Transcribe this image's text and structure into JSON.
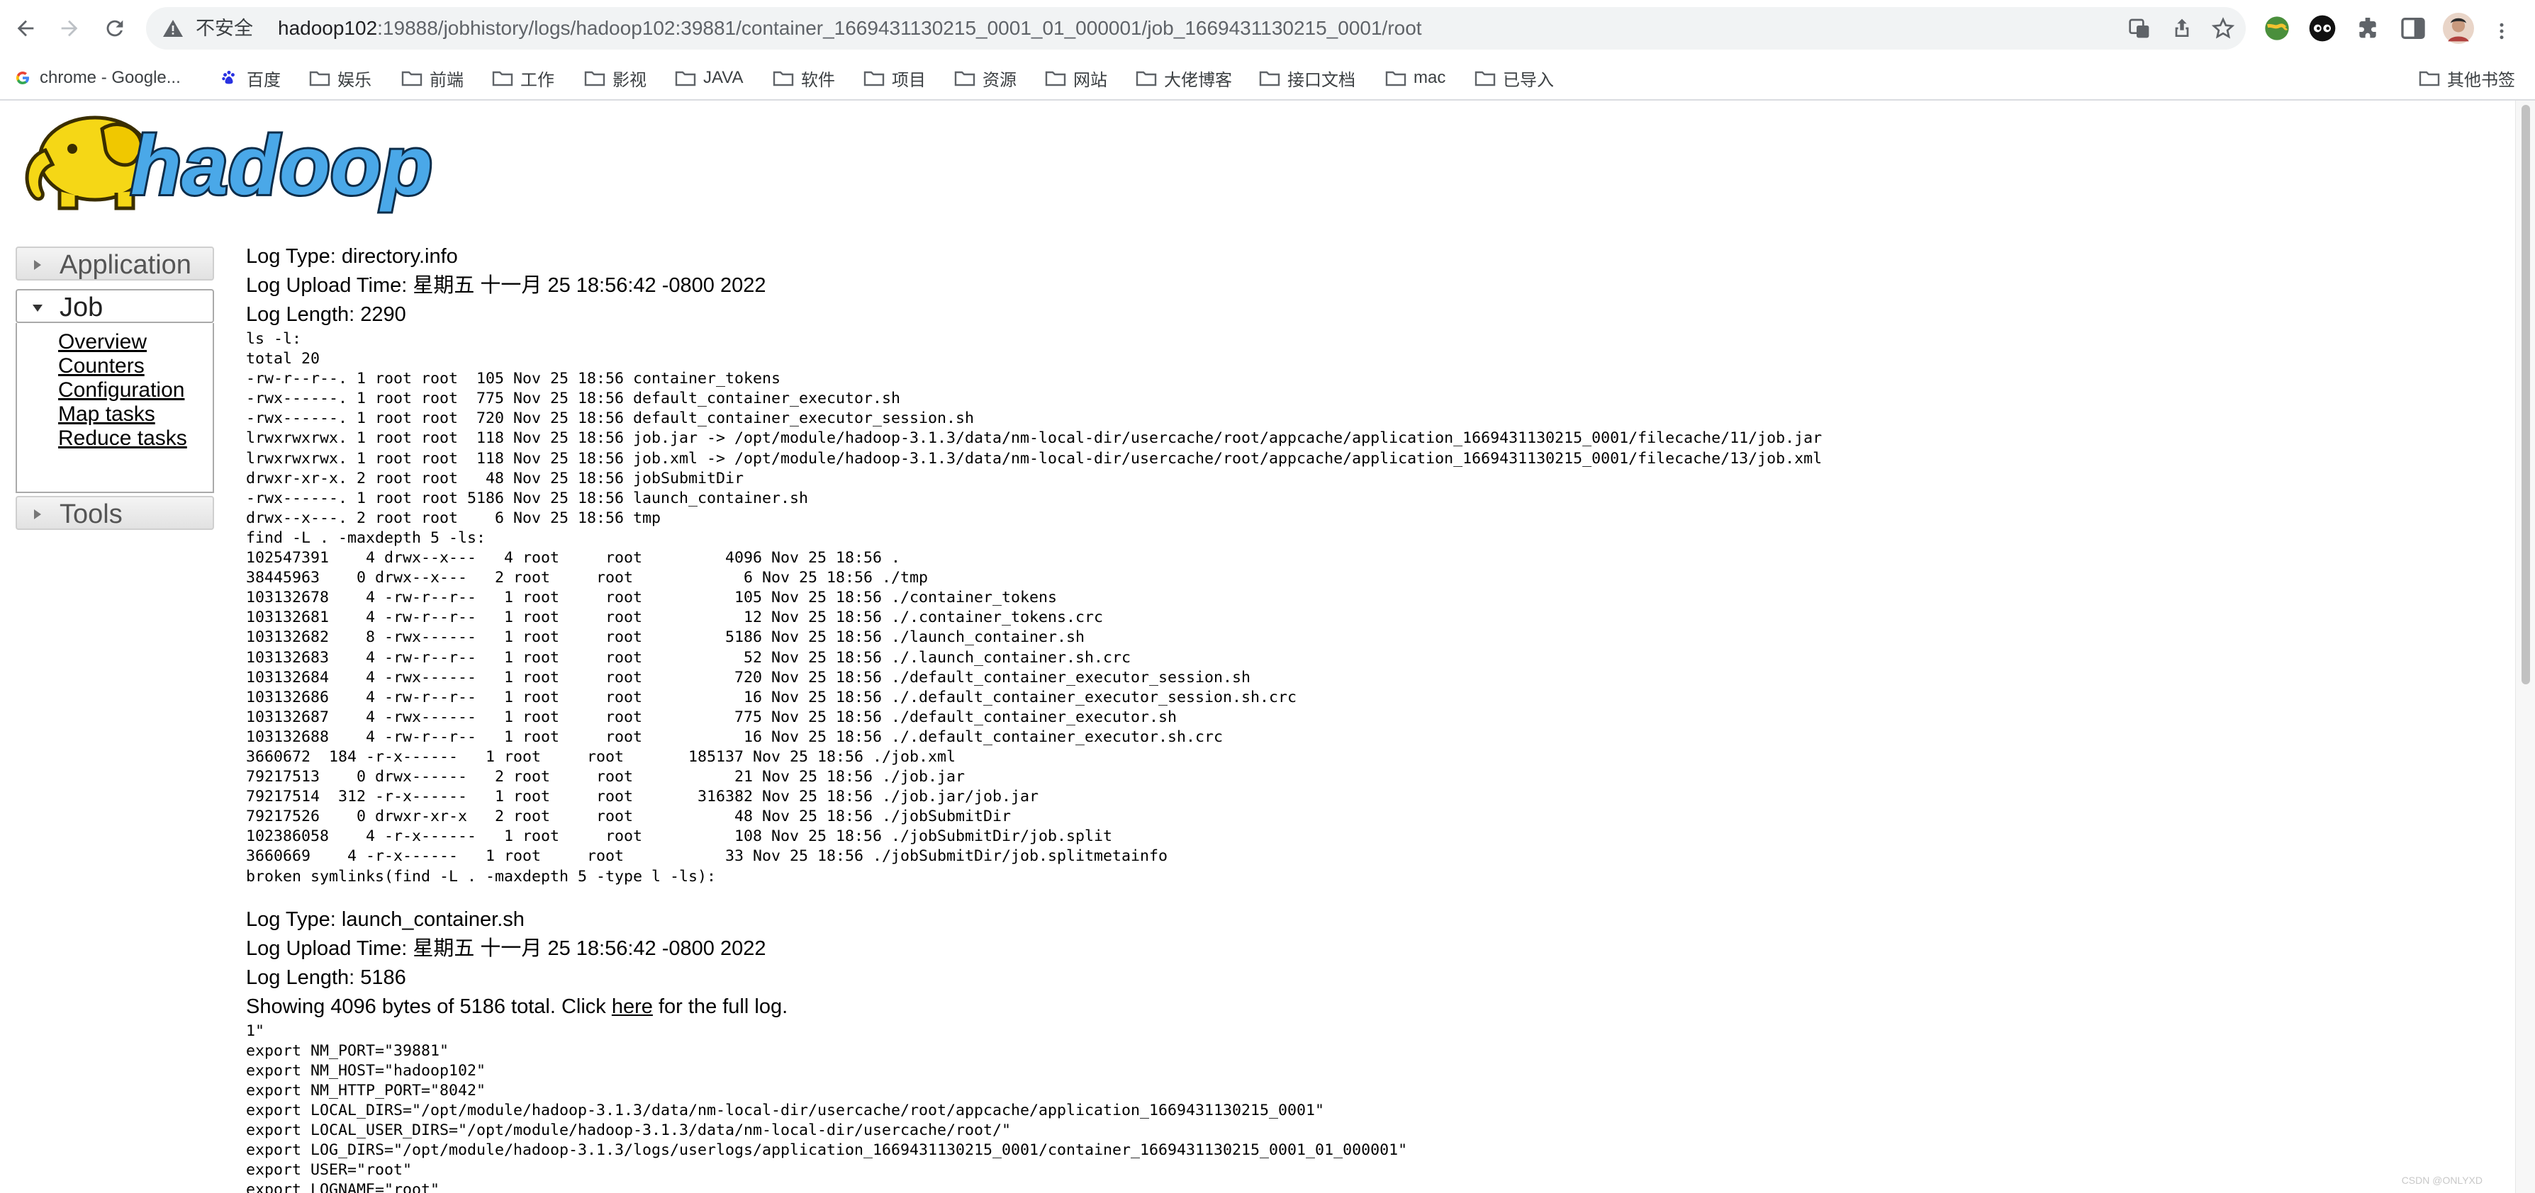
{
  "browser": {
    "insecure_label": "不安全",
    "url_host": "hadoop102",
    "url_rest": ":19888/jobhistory/logs/hadoop102:39881/container_1669431130215_0001_01_000001/job_1669431130215_0001/root",
    "bookmarks": [
      "chrome - Google...",
      "百度",
      "娱乐",
      "前端",
      "工作",
      "影视",
      "JAVA",
      "软件",
      "项目",
      "资源",
      "网站",
      "大佬博客",
      "接口文档",
      "mac",
      "已导入"
    ],
    "other_bookmarks": "其他书签"
  },
  "logo_text": "hadoop",
  "nav": {
    "application": "Application",
    "job": "Job",
    "job_links": [
      "Overview",
      "Counters",
      "Configuration",
      "Map tasks",
      "Reduce tasks"
    ],
    "tools": "Tools"
  },
  "log1": {
    "type": "Log Type: directory.info",
    "upload": "Log Upload Time: 星期五 十一月 25 18:56:42 -0800 2022",
    "length": "Log Length: 2290",
    "body": "ls -l:\ntotal 20\n-rw-r--r--. 1 root root  105 Nov 25 18:56 container_tokens\n-rwx------. 1 root root  775 Nov 25 18:56 default_container_executor.sh\n-rwx------. 1 root root  720 Nov 25 18:56 default_container_executor_session.sh\nlrwxrwxrwx. 1 root root  118 Nov 25 18:56 job.jar -> /opt/module/hadoop-3.1.3/data/nm-local-dir/usercache/root/appcache/application_1669431130215_0001/filecache/11/job.jar\nlrwxrwxrwx. 1 root root  118 Nov 25 18:56 job.xml -> /opt/module/hadoop-3.1.3/data/nm-local-dir/usercache/root/appcache/application_1669431130215_0001/filecache/13/job.xml\ndrwxr-xr-x. 2 root root   48 Nov 25 18:56 jobSubmitDir\n-rwx------. 1 root root 5186 Nov 25 18:56 launch_container.sh\ndrwx--x---. 2 root root    6 Nov 25 18:56 tmp\nfind -L . -maxdepth 5 -ls:\n102547391    4 drwx--x---   4 root     root         4096 Nov 25 18:56 .\n38445963    0 drwx--x---   2 root     root            6 Nov 25 18:56 ./tmp\n103132678    4 -rw-r--r--   1 root     root          105 Nov 25 18:56 ./container_tokens\n103132681    4 -rw-r--r--   1 root     root           12 Nov 25 18:56 ./.container_tokens.crc\n103132682    8 -rwx------   1 root     root         5186 Nov 25 18:56 ./launch_container.sh\n103132683    4 -rw-r--r--   1 root     root           52 Nov 25 18:56 ./.launch_container.sh.crc\n103132684    4 -rwx------   1 root     root          720 Nov 25 18:56 ./default_container_executor_session.sh\n103132686    4 -rw-r--r--   1 root     root           16 Nov 25 18:56 ./.default_container_executor_session.sh.crc\n103132687    4 -rwx------   1 root     root          775 Nov 25 18:56 ./default_container_executor.sh\n103132688    4 -rw-r--r--   1 root     root           16 Nov 25 18:56 ./.default_container_executor.sh.crc\n3660672  184 -r-x------   1 root     root       185137 Nov 25 18:56 ./job.xml\n79217513    0 drwx------   2 root     root           21 Nov 25 18:56 ./job.jar\n79217514  312 -r-x------   1 root     root       316382 Nov 25 18:56 ./job.jar/job.jar\n79217526    0 drwxr-xr-x   2 root     root           48 Nov 25 18:56 ./jobSubmitDir\n102386058    4 -r-x------   1 root     root          108 Nov 25 18:56 ./jobSubmitDir/job.split\n3660669    4 -r-x------   1 root     root           33 Nov 25 18:56 ./jobSubmitDir/job.splitmetainfo\nbroken symlinks(find -L . -maxdepth 5 -type l -ls):"
  },
  "log2": {
    "type": "Log Type: launch_container.sh",
    "upload": "Log Upload Time: 星期五 十一月 25 18:56:42 -0800 2022",
    "length": "Log Length: 5186",
    "showing_pre": "Showing 4096 bytes of 5186 total. Click ",
    "here": "here",
    "showing_post": " for the full log.",
    "body": "1\"\nexport NM_PORT=\"39881\"\nexport NM_HOST=\"hadoop102\"\nexport NM_HTTP_PORT=\"8042\"\nexport LOCAL_DIRS=\"/opt/module/hadoop-3.1.3/data/nm-local-dir/usercache/root/appcache/application_1669431130215_0001\"\nexport LOCAL_USER_DIRS=\"/opt/module/hadoop-3.1.3/data/nm-local-dir/usercache/root/\"\nexport LOG_DIRS=\"/opt/module/hadoop-3.1.3/logs/userlogs/application_1669431130215_0001/container_1669431130215_0001_01_000001\"\nexport USER=\"root\"\nexport LOGNAME=\"root\""
  },
  "watermark": "CSDN @ONLYXD",
  "colors": {
    "accent": "#1a73e8",
    "logo_yellow": "#f5d716",
    "logo_blue": "#4aa8e8"
  }
}
